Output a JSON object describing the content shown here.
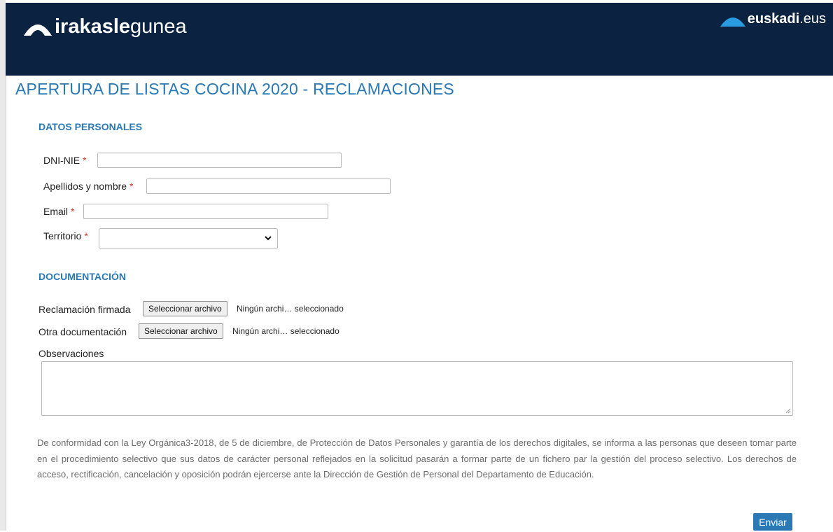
{
  "header": {
    "logo_bold": "irakasle",
    "logo_thin": "gunea",
    "partner_bold": "euskadi",
    "partner_thin": ".eus",
    "icons": {
      "logo": "arc-logo-icon",
      "partner": "arc-logo-icon"
    },
    "background_color": "#0b2340"
  },
  "page_title": "APERTURA DE LISTAS COCINA 2020 - RECLAMACIONES",
  "personal": {
    "section_title": "DATOS PERSONALES",
    "dni_label": "DNI-NIE",
    "name_label": "Apellidos y nombre",
    "email_label": "Email",
    "territory_label": "Territorio",
    "required_mark": "*",
    "territory_value": ""
  },
  "documentation": {
    "section_title": "DOCUMENTACIÓN",
    "signed_label": "Reclamación firmada",
    "other_label": "Otra documentación",
    "file_button_label": "Seleccionar archivo",
    "file_status": "Ningún archi… seleccionado",
    "observations_label": "Observaciones"
  },
  "notice_text": "De conformidad con la Ley Orgánica3-2018, de 5 de diciembre, de Protección de Datos Personales y garantía de los derechos digitales, se informa a las personas que deseen tomar parte en el procedimiento selectivo que sus datos de carácter personal reflejados en la solicitud pasarán a formar parte de un fichero par la gestión del proceso selectivo. Los derechos de acceso, rectificación, cancelación y oposición podrán ejercerse ante la Dirección de Gestión de Personal del Departamento de Educación.",
  "submit_label": "Enviar",
  "colors": {
    "accent": "#2a78b4",
    "required": "#d9382b"
  }
}
